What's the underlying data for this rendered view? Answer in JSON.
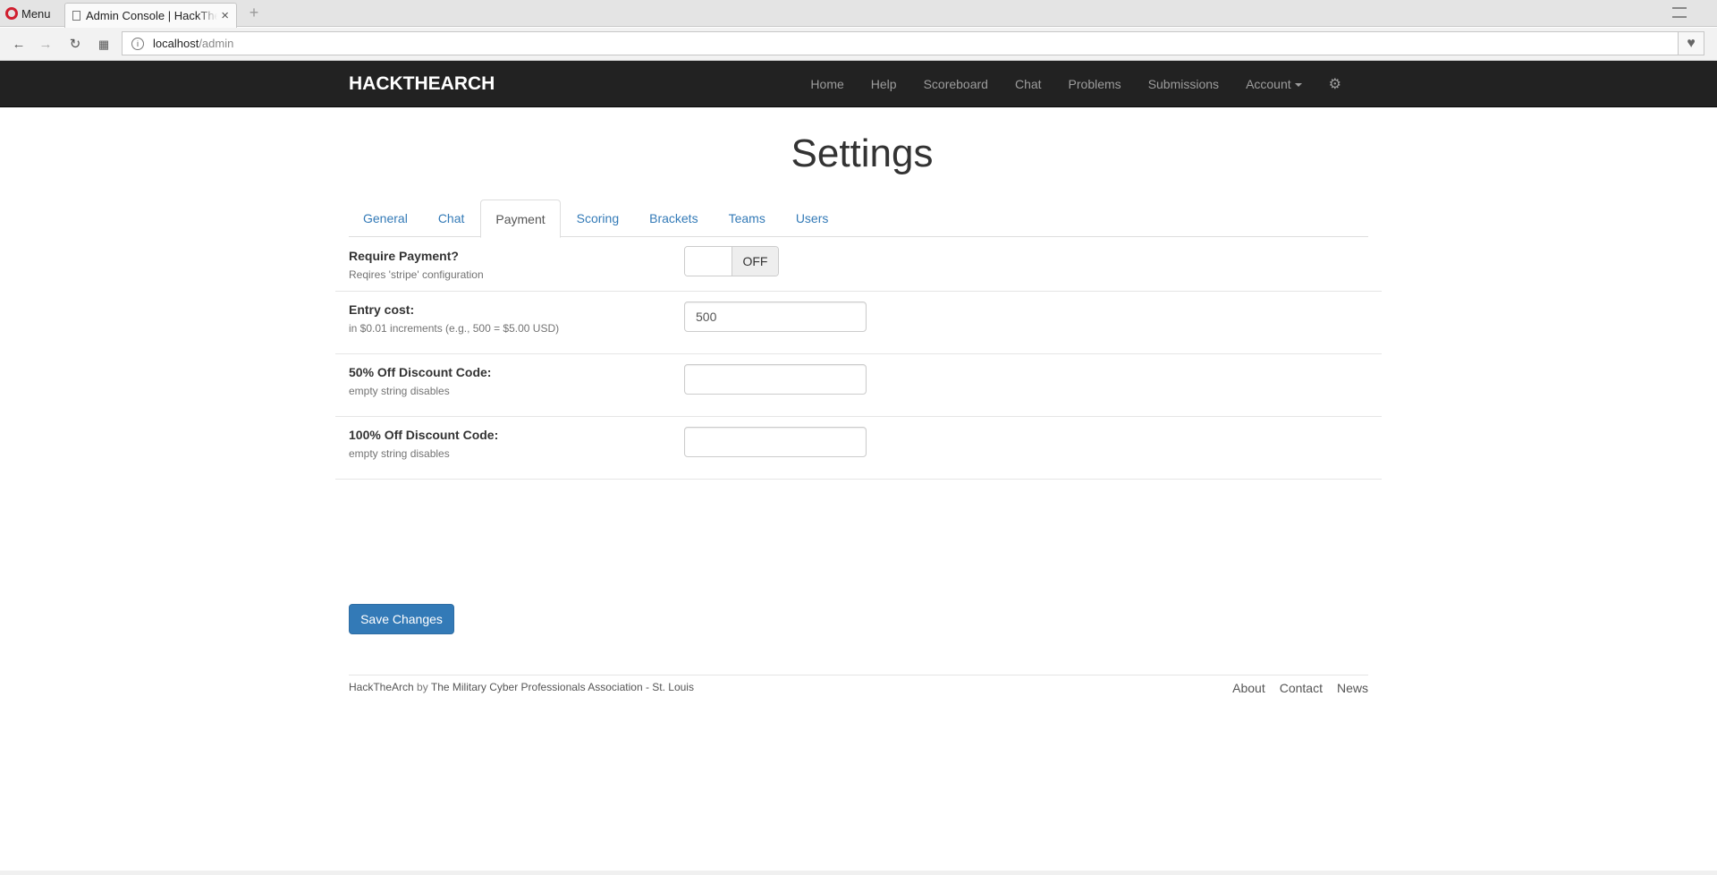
{
  "browser": {
    "menu_label": "Menu",
    "tab_title": "Admin Console | HackTheArch",
    "tab_close": "×",
    "new_tab": "+",
    "url_host": "localhost",
    "url_path": "/admin"
  },
  "site": {
    "brand": "HACKTHEARCH",
    "nav": [
      "Home",
      "Help",
      "Scoreboard",
      "Chat",
      "Problems",
      "Submissions"
    ],
    "account_label": "Account"
  },
  "page": {
    "title": "Settings",
    "tabs": [
      "General",
      "Chat",
      "Payment",
      "Scoring",
      "Brackets",
      "Teams",
      "Users"
    ],
    "active_tab": "Payment"
  },
  "form": {
    "require_payment": {
      "label": "Require Payment?",
      "help": "Reqires 'stripe' configuration",
      "state": "OFF"
    },
    "entry_cost": {
      "label": "Entry cost:",
      "help": "in $0.01 increments (e.g., 500 = $5.00 USD)",
      "value": "500"
    },
    "discount_50": {
      "label": "50% Off Discount Code:",
      "help": "empty string disables",
      "value": ""
    },
    "discount_100": {
      "label": "100% Off Discount Code:",
      "help": "empty string disables",
      "value": ""
    },
    "save_label": "Save Changes"
  },
  "footer": {
    "app_name": "HackTheArch",
    "by": "by",
    "org": "The Military Cyber Professionals Association - St. Louis",
    "links": [
      "About",
      "Contact",
      "News"
    ]
  },
  "colors": {
    "navbar_bg": "#222222",
    "link": "#337ab7",
    "primary_button": "#337ab7"
  }
}
